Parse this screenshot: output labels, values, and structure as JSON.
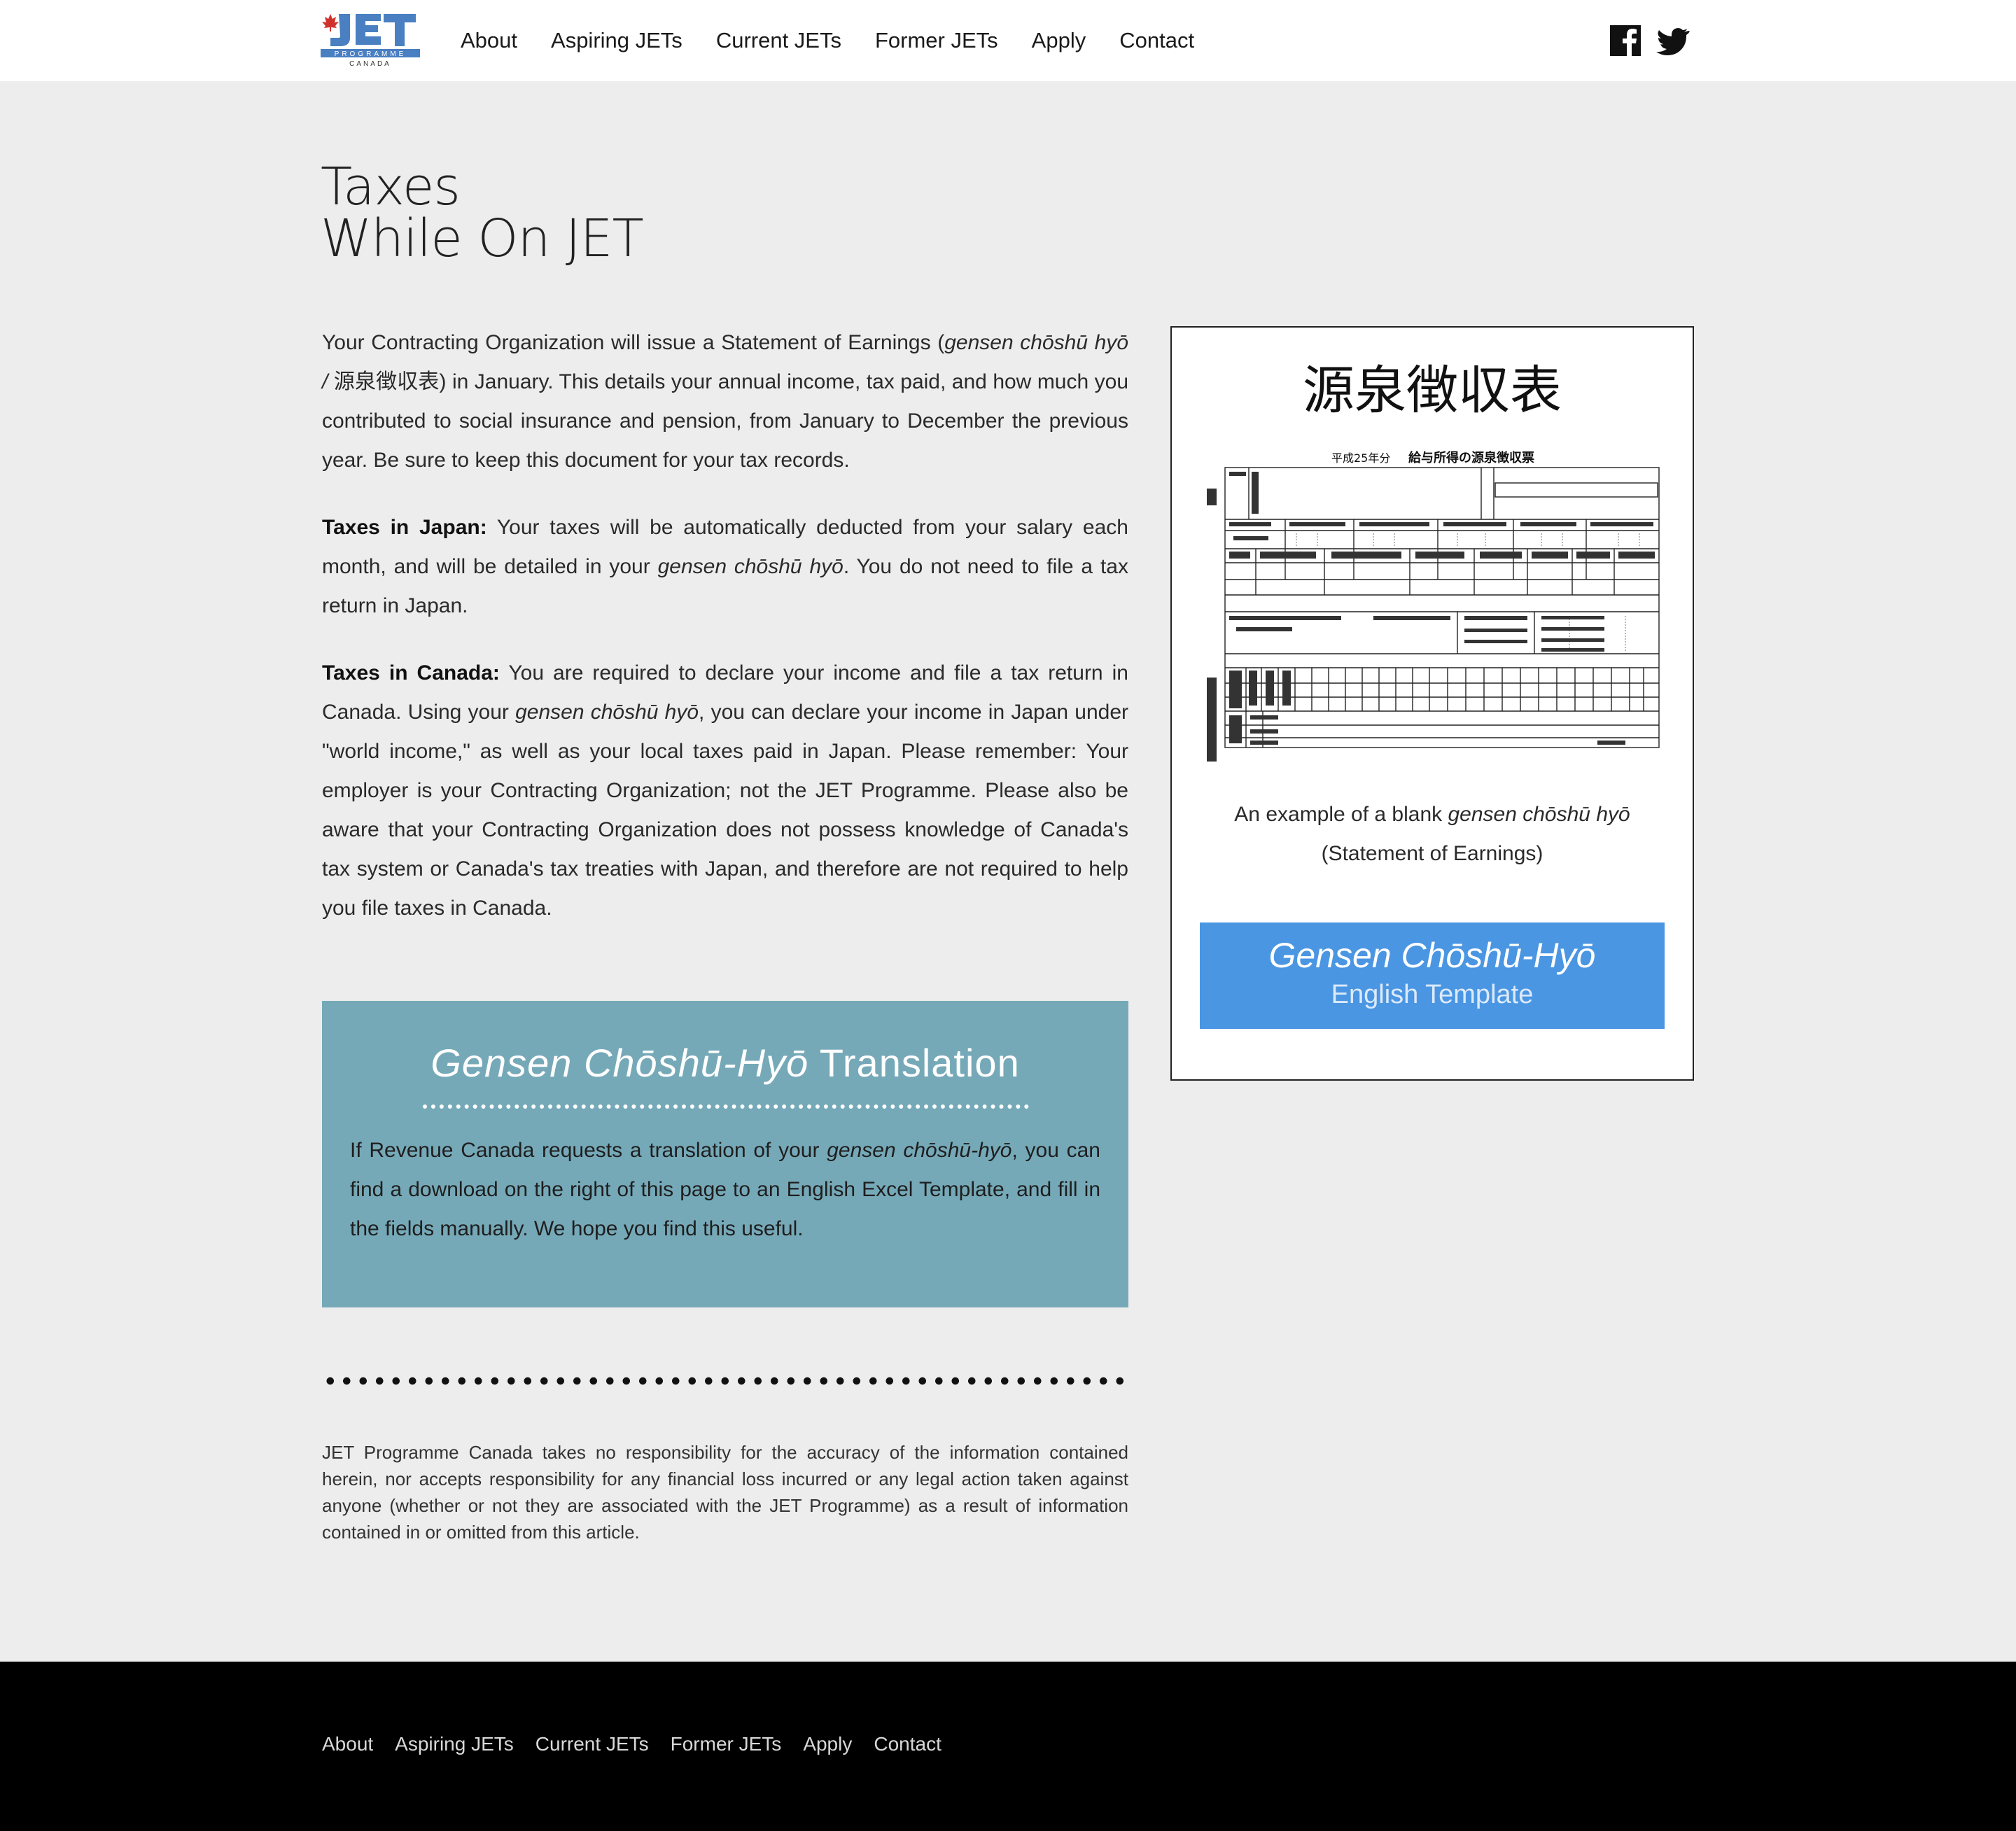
{
  "header": {
    "logo_text": "JET",
    "logo_sub": "PROGRAMME",
    "logo_country": "CANADA",
    "nav": [
      "About",
      "Aspiring JETs",
      "Current JETs",
      "Former JETs",
      "Apply",
      "Contact"
    ],
    "social_icons": [
      "facebook-icon",
      "twitter-icon"
    ]
  },
  "page": {
    "title_line1": "Taxes",
    "title_line2": "While On JET",
    "p1_a": "Your Contracting Organization will issue a Statement of Earnings (",
    "p1_italic": "gensen chōshū hyō",
    "p1_b": " / ",
    "p1_kanji": "源泉徴収表",
    "p1_c": ") in January. This details your annual income, tax paid, and how much you contributed to social insurance and pension, from January to December the previous year. Be sure to keep this document for your tax records.",
    "p2_bold": "Taxes in Japan:",
    "p2_a": " Your taxes will be automatically deducted from your salary each month, and will be detailed in your ",
    "p2_italic": "gensen chōshū hyō",
    "p2_b": ".  You do not need to file a tax return in Japan.",
    "p3_bold": "Taxes in Canada:",
    "p3_a": " You are required to declare your income and file a tax return in Canada. Using your ",
    "p3_italic": "gensen chōshū hyō",
    "p3_b": ", you can declare your income in Japan under \"world income,\" as well as your local taxes paid in Japan. Please remember: Your employer is your Contracting Organization; not the JET Programme.  Please also be aware that your Contracting Organization does not possess knowledge of Canada's tax system or Canada's tax treaties with Japan, and therefore are not required to help you file taxes in Canada."
  },
  "translation": {
    "title_italic": "Gensen Chōshū-Hyō",
    "title_rest": " Translation",
    "body_a": "If Revenue Canada requests a translation of your ",
    "body_italic": "gensen chōshū-hyō",
    "body_b": ", you can find a download on the right of this page to an English Excel Template, and fill in the fields manually. We hope you find this useful."
  },
  "disclaimer": "JET Programme Canada takes no responsibility for the accuracy of the information contained herein, nor accepts responsibility for any financial loss incurred or any legal action taken against anyone (whether or not they are associated with the JET Programme) as a result of information contained in or omitted from this article.",
  "card": {
    "kanji_title": "源泉徴収表",
    "form_header_year": "平成25年分",
    "form_header_title": "給与所得の源泉徴収票",
    "caption_a": "An example of a blank ",
    "caption_italic": "gensen chōshū hyō",
    "caption_b": "(Statement of Earnings)",
    "button_line1": "Gensen Chōshū-Hyō",
    "button_line2": "English Template"
  },
  "footer": {
    "nav": [
      "About",
      "Aspiring JETs",
      "Current JETs",
      "Former JETs",
      "Apply",
      "Contact"
    ]
  },
  "colors": {
    "header_bg": "#ffffff",
    "page_bg": "#ededed",
    "translation_bg": "#76a9b8",
    "button_bg": "#4a96e2",
    "footer_bg": "#000000",
    "logo_blue": "#4a7fc1",
    "maple_red": "#d0312d"
  }
}
